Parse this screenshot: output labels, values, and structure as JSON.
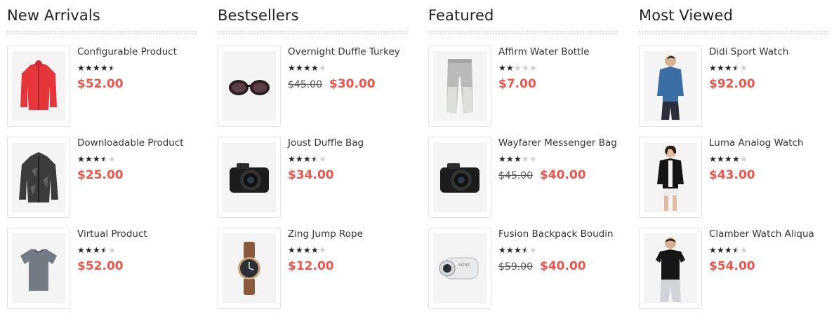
{
  "columns": [
    {
      "title": "New Arrivals",
      "items": [
        {
          "name": "Configurable Product",
          "rating": 4.5,
          "old_price": "",
          "price": "$52.00",
          "image_icon": "red-jacket-image"
        },
        {
          "name": "Downloadable Product",
          "rating": 3.5,
          "old_price": "",
          "price": "$25.00",
          "image_icon": "camo-jacket-image"
        },
        {
          "name": "Virtual Product",
          "rating": 3.5,
          "old_price": "",
          "price": "$52.00",
          "image_icon": "gray-tshirt-image"
        }
      ]
    },
    {
      "title": "Bestsellers",
      "items": [
        {
          "name": "Overnight Duffle Turkey",
          "rating": 4,
          "old_price": "$45.00",
          "price": "$30.00",
          "image_icon": "sunglasses-image"
        },
        {
          "name": "Joust Duffle Bag",
          "rating": 3.5,
          "old_price": "",
          "price": "$34.00",
          "image_icon": "camera-image"
        },
        {
          "name": "Zing Jump Rope",
          "rating": 4,
          "old_price": "",
          "price": "$12.00",
          "image_icon": "wristwatch-image"
        }
      ]
    },
    {
      "title": "Featured",
      "items": [
        {
          "name": "Affirm Water Bottle",
          "rating": 2,
          "old_price": "",
          "price": "$7.00",
          "image_icon": "sweatpants-image"
        },
        {
          "name": "Wayfarer Messenger Bag",
          "rating": 3,
          "old_price": "$45.00",
          "price": "$40.00",
          "image_icon": "camera-image"
        },
        {
          "name": "Fusion Backpack Boudin",
          "rating": 3.5,
          "old_price": "$59.00",
          "price": "$40.00",
          "image_icon": "action-camera-image"
        }
      ]
    },
    {
      "title": "Most Viewed",
      "items": [
        {
          "name": "Didi Sport Watch",
          "rating": 3.5,
          "old_price": "",
          "price": "$92.00",
          "image_icon": "man-blue-shirt-image"
        },
        {
          "name": "Luma Analog Watch",
          "rating": 4,
          "old_price": "",
          "price": "$43.00",
          "image_icon": "woman-black-jacket-image"
        },
        {
          "name": "Clamber Watch Aliqua",
          "rating": 3.5,
          "old_price": "",
          "price": "$54.00",
          "image_icon": "man-black-tshirt-image"
        }
      ]
    }
  ],
  "colors": {
    "price": "#e8564e",
    "star_on": "#222222",
    "star_off": "#cfcfcf",
    "old_price": "#555555"
  }
}
